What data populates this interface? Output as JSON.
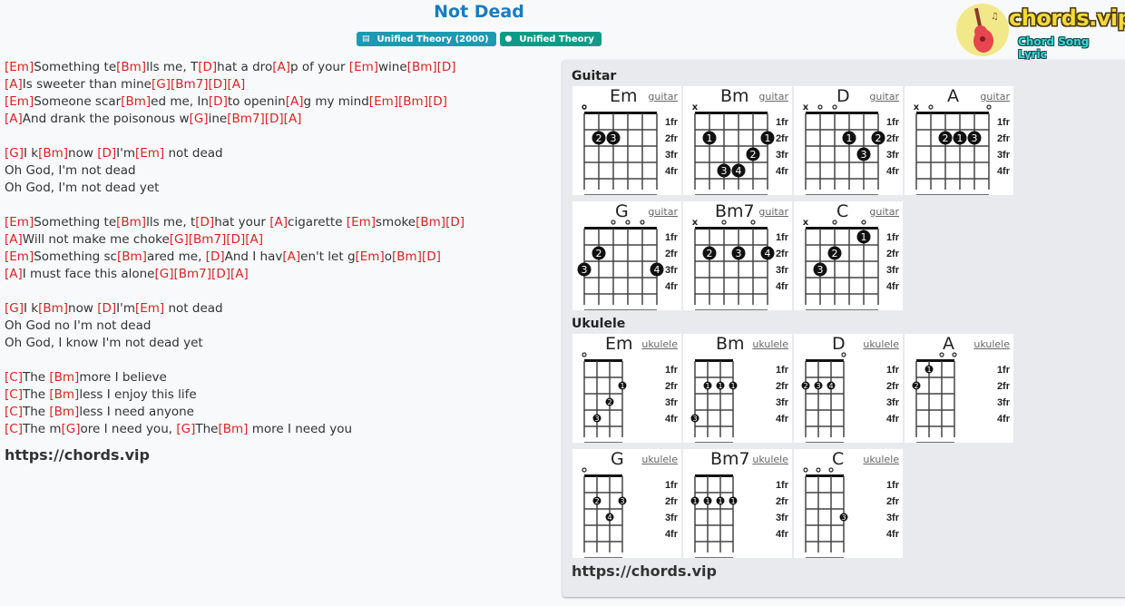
{
  "song": {
    "title": "Not Dead",
    "album_badge": "Unified Theory (2000)",
    "artist_badge": "Unified Theory",
    "album_icon": "book-icon",
    "artist_icon": "user-icon"
  },
  "logo": {
    "brand": "chords.vip",
    "tagline": "Chord Song Lyric",
    "icon": "guitar-icon"
  },
  "colors": {
    "chord": "#d42424",
    "title": "#1a7bc0",
    "album_badge": "#1b9ab0",
    "artist_badge": "#0d9b87"
  },
  "lyrics": [
    [
      [
        "c",
        "Em"
      ],
      [
        "t",
        "Something te"
      ],
      [
        "c",
        "Bm"
      ],
      [
        "t",
        "lls me, T"
      ],
      [
        "c",
        "D"
      ],
      [
        "t",
        "hat a dro"
      ],
      [
        "c",
        "A"
      ],
      [
        "t",
        "p of your "
      ],
      [
        "c",
        "Em"
      ],
      [
        "t",
        "wine"
      ],
      [
        "c",
        "Bm"
      ],
      [
        "c",
        "D"
      ]
    ],
    [
      [
        "c",
        "A"
      ],
      [
        "t",
        "Is sweeter than mine"
      ],
      [
        "c",
        "G"
      ],
      [
        "c",
        "Bm7"
      ],
      [
        "c",
        "D"
      ],
      [
        "c",
        "A"
      ]
    ],
    [
      [
        "c",
        "Em"
      ],
      [
        "t",
        "Someone scar"
      ],
      [
        "c",
        "Bm"
      ],
      [
        "t",
        "ed me, In"
      ],
      [
        "c",
        "D"
      ],
      [
        "t",
        "to openin"
      ],
      [
        "c",
        "A"
      ],
      [
        "t",
        "g my mind"
      ],
      [
        "c",
        "Em"
      ],
      [
        "c",
        "Bm"
      ],
      [
        "c",
        "D"
      ]
    ],
    [
      [
        "c",
        "A"
      ],
      [
        "t",
        "And drank the poisonous w"
      ],
      [
        "c",
        "G"
      ],
      [
        "t",
        "ine"
      ],
      [
        "c",
        "Bm7"
      ],
      [
        "c",
        "D"
      ],
      [
        "c",
        "A"
      ]
    ],
    [],
    [
      [
        "c",
        "G"
      ],
      [
        "t",
        "I k"
      ],
      [
        "c",
        "Bm"
      ],
      [
        "t",
        "now "
      ],
      [
        "c",
        "D"
      ],
      [
        "t",
        "I'm"
      ],
      [
        "c",
        "Em"
      ],
      [
        "t",
        " not dead"
      ]
    ],
    [
      [
        "t",
        "Oh God, I'm not dead"
      ]
    ],
    [
      [
        "t",
        "Oh God, I'm not dead yet"
      ]
    ],
    [],
    [
      [
        "c",
        "Em"
      ],
      [
        "t",
        "Something te"
      ],
      [
        "c",
        "Bm"
      ],
      [
        "t",
        "lls me, t"
      ],
      [
        "c",
        "D"
      ],
      [
        "t",
        "hat your "
      ],
      [
        "c",
        "A"
      ],
      [
        "t",
        "cigarette "
      ],
      [
        "c",
        "Em"
      ],
      [
        "t",
        "smoke"
      ],
      [
        "c",
        "Bm"
      ],
      [
        "c",
        "D"
      ]
    ],
    [
      [
        "c",
        "A"
      ],
      [
        "t",
        "Will not make me choke"
      ],
      [
        "c",
        "G"
      ],
      [
        "c",
        "Bm7"
      ],
      [
        "c",
        "D"
      ],
      [
        "c",
        "A"
      ]
    ],
    [
      [
        "c",
        "Em"
      ],
      [
        "t",
        "Something sc"
      ],
      [
        "c",
        "Bm"
      ],
      [
        "t",
        "ared me, "
      ],
      [
        "c",
        "D"
      ],
      [
        "t",
        "And I hav"
      ],
      [
        "c",
        "A"
      ],
      [
        "t",
        "en't let g"
      ],
      [
        "c",
        "Em"
      ],
      [
        "t",
        "o"
      ],
      [
        "c",
        "Bm"
      ],
      [
        "c",
        "D"
      ]
    ],
    [
      [
        "c",
        "A"
      ],
      [
        "t",
        "I must face this alone"
      ],
      [
        "c",
        "G"
      ],
      [
        "c",
        "Bm7"
      ],
      [
        "c",
        "D"
      ],
      [
        "c",
        "A"
      ]
    ],
    [],
    [
      [
        "c",
        "G"
      ],
      [
        "t",
        "I k"
      ],
      [
        "c",
        "Bm"
      ],
      [
        "t",
        "now "
      ],
      [
        "c",
        "D"
      ],
      [
        "t",
        "I'm"
      ],
      [
        "c",
        "Em"
      ],
      [
        "t",
        " not dead"
      ]
    ],
    [
      [
        "t",
        "Oh God no I'm not dead"
      ]
    ],
    [
      [
        "t",
        "Oh God, I know I'm not dead yet"
      ]
    ],
    [],
    [
      [
        "c",
        "C"
      ],
      [
        "t",
        "The "
      ],
      [
        "c",
        "Bm"
      ],
      [
        "t",
        "more I believe"
      ]
    ],
    [
      [
        "c",
        "C"
      ],
      [
        "t",
        "The "
      ],
      [
        "c",
        "Bm"
      ],
      [
        "t",
        "less I enjoy this life"
      ]
    ],
    [
      [
        "c",
        "C"
      ],
      [
        "t",
        "The "
      ],
      [
        "c",
        "Bm"
      ],
      [
        "t",
        "less I need anyone"
      ]
    ],
    [
      [
        "c",
        "C"
      ],
      [
        "t",
        "The m"
      ],
      [
        "c",
        "G"
      ],
      [
        "t",
        "ore I need you, "
      ],
      [
        "c",
        "G"
      ],
      [
        "t",
        "The"
      ],
      [
        "c",
        "Bm"
      ],
      [
        "t",
        " more I need you"
      ]
    ]
  ],
  "lyrics_site": "https://chords.vip",
  "panel": {
    "guitar_title": "Guitar",
    "ukulele_title": "Ukulele",
    "site": "https://chords.vip",
    "fret_labels": [
      "1fr",
      "2fr",
      "3fr",
      "4fr"
    ],
    "guitar_link": "guitar",
    "ukulele_link": "ukulele",
    "guitar_chords": [
      {
        "name": "Em",
        "open": [
          0,
          null,
          null,
          0,
          0,
          0
        ],
        "muted": [],
        "dots": [
          [
            1,
            2,
            "2"
          ],
          [
            2,
            2,
            "3"
          ]
        ]
      },
      {
        "name": "Bm",
        "open": [],
        "muted": [
          0
        ],
        "dots": [
          [
            1,
            2,
            "1"
          ],
          [
            5,
            2,
            "1"
          ],
          [
            4,
            3,
            "2"
          ],
          [
            2,
            4,
            "3"
          ],
          [
            3,
            4,
            "4"
          ]
        ]
      },
      {
        "name": "D",
        "open": [
          1,
          2
        ],
        "muted": [
          0
        ],
        "dots": [
          [
            3,
            2,
            "1"
          ],
          [
            5,
            2,
            "2"
          ],
          [
            4,
            3,
            "3"
          ]
        ]
      },
      {
        "name": "A",
        "open": [
          1,
          5
        ],
        "muted": [
          0
        ],
        "dots": [
          [
            2,
            2,
            "2"
          ],
          [
            3,
            2,
            "1"
          ],
          [
            4,
            2,
            "3"
          ]
        ]
      },
      {
        "name": "G",
        "open": [
          2,
          3,
          4
        ],
        "muted": [],
        "dots": [
          [
            1,
            2,
            "2"
          ],
          [
            0,
            3,
            "3"
          ],
          [
            5,
            3,
            "4"
          ]
        ]
      },
      {
        "name": "Bm7",
        "open": [
          2,
          4
        ],
        "muted": [
          0
        ],
        "dots": [
          [
            1,
            2,
            "2"
          ],
          [
            3,
            2,
            "3"
          ],
          [
            5,
            2,
            "4"
          ]
        ]
      },
      {
        "name": "C",
        "open": [
          2,
          4
        ],
        "muted": [
          0
        ],
        "dots": [
          [
            4,
            1,
            "1"
          ],
          [
            2,
            2,
            "2"
          ],
          [
            1,
            3,
            "3"
          ]
        ]
      }
    ],
    "ukulele_chords": [
      {
        "name": "Em",
        "open": [
          0
        ],
        "dots": [
          [
            3,
            2,
            "1"
          ],
          [
            2,
            3,
            "2"
          ],
          [
            1,
            4,
            "3"
          ]
        ]
      },
      {
        "name": "Bm",
        "open": [],
        "dots": [
          [
            1,
            2,
            "1"
          ],
          [
            2,
            2,
            "1"
          ],
          [
            3,
            2,
            "1"
          ],
          [
            0,
            4,
            "3"
          ]
        ]
      },
      {
        "name": "D",
        "open": [
          3
        ],
        "dots": [
          [
            0,
            2,
            "2"
          ],
          [
            1,
            2,
            "3"
          ],
          [
            2,
            2,
            "4"
          ]
        ]
      },
      {
        "name": "A",
        "open": [
          2,
          3
        ],
        "dots": [
          [
            1,
            1,
            "1"
          ],
          [
            0,
            2,
            "2"
          ]
        ]
      },
      {
        "name": "G",
        "open": [
          0
        ],
        "dots": [
          [
            1,
            2,
            "2"
          ],
          [
            3,
            2,
            "3"
          ],
          [
            2,
            3,
            "4"
          ]
        ]
      },
      {
        "name": "Bm7",
        "open": [],
        "dots": [
          [
            0,
            2,
            "1"
          ],
          [
            1,
            2,
            "1"
          ],
          [
            2,
            2,
            "1"
          ],
          [
            3,
            2,
            "1"
          ]
        ]
      },
      {
        "name": "C",
        "open": [
          0,
          1,
          2
        ],
        "dots": [
          [
            3,
            3,
            "3"
          ]
        ]
      }
    ]
  }
}
